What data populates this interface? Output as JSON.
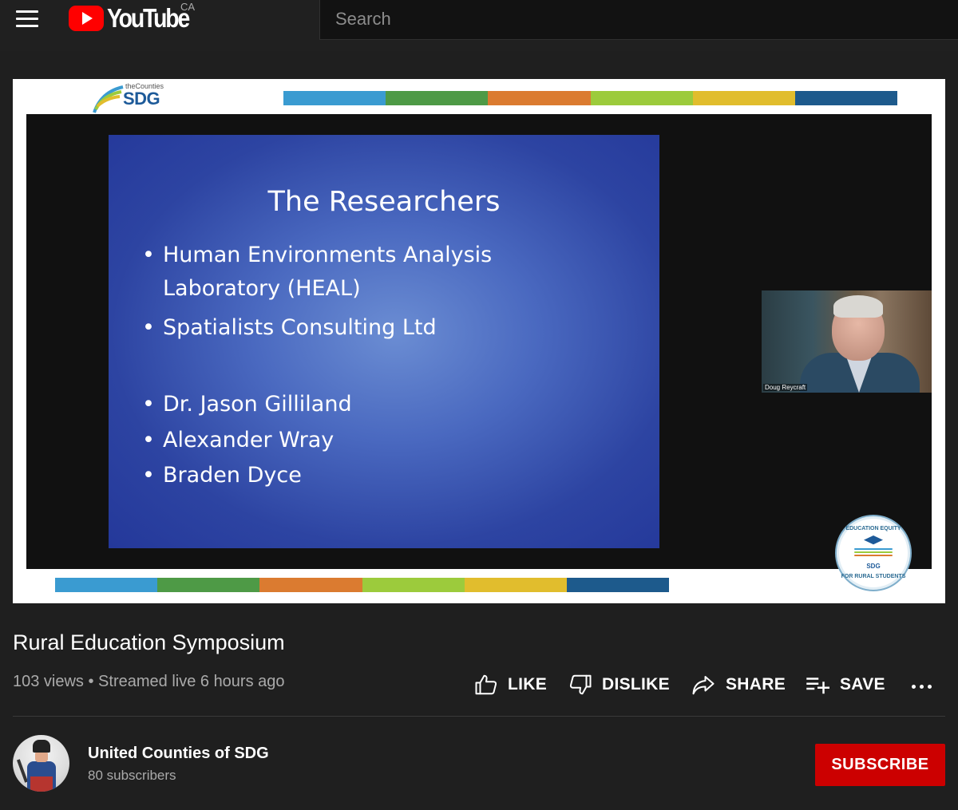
{
  "header": {
    "logo_text": "YouTube",
    "region": "CA",
    "search_placeholder": "Search"
  },
  "video": {
    "sdg_logo_small": "theCounties",
    "sdg_logo_big": "SDG",
    "stripe_colors": [
      "#3a9bd1",
      "#4e9a46",
      "#db7b30",
      "#9ccb3c",
      "#e1bd2d",
      "#1d5a8c"
    ],
    "slide": {
      "title": "The Researchers",
      "bullets": [
        "Human Environments Analysis",
        "Laboratory (HEAL)",
        "Spatialists Consulting Ltd",
        "Dr. Jason Gilliland",
        "Alexander Wray",
        "Braden Dyce"
      ]
    },
    "speaker_name": "Doug Reycraft",
    "badge": {
      "top_text": "EDUCATION EQUITY",
      "bottom_text": "FOR RURAL STUDENTS",
      "center_text": "SDG"
    }
  },
  "title": "Rural Education Symposium",
  "meta": "103 views • Streamed live 6 hours ago",
  "actions": {
    "like": "LIKE",
    "dislike": "DISLIKE",
    "share": "SHARE",
    "save": "SAVE"
  },
  "channel": {
    "name": "United Counties of SDG",
    "subscribers": "80 subscribers",
    "subscribe_label": "SUBSCRIBE"
  },
  "colors": {
    "accent_red": "#cc0000",
    "background": "#1f1f1f",
    "slide_blue": "#3552ae"
  }
}
